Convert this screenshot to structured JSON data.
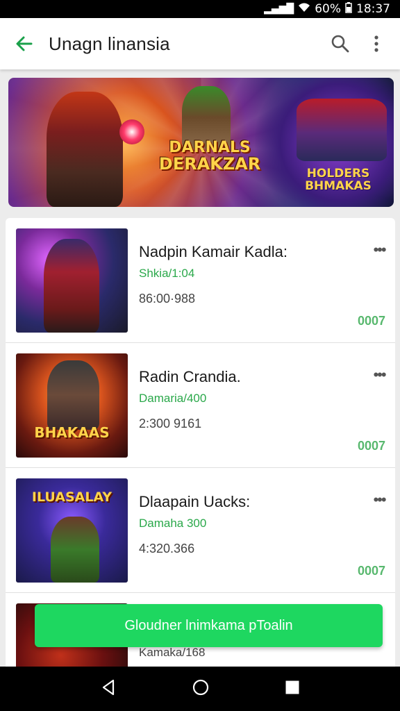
{
  "status_bar": {
    "signal": "▲▂▄▆",
    "battery_text": "60%",
    "time": "18:37"
  },
  "app_bar": {
    "title": "Unagn linansia"
  },
  "banner": {
    "title_line1": "DARNALS",
    "title_line2": "DERAKZAR",
    "right_title": "HOLDERS BHMAKAS"
  },
  "list": [
    {
      "title": "Nadpin Kamair Kadla:",
      "subtitle": "Shkia/1:04",
      "meta": "86:00·988",
      "count": "0007",
      "thumb_label": ""
    },
    {
      "title": "Radin Crandia.",
      "subtitle": "Damaria/400",
      "meta": "2:300 9161",
      "count": "0007",
      "thumb_label": "BHAKAAS"
    },
    {
      "title": "Dlaapain Uacks:",
      "subtitle": "Damaha 300",
      "meta": "4:320.366",
      "count": "0007",
      "thumb_label": "ILUASALAY"
    },
    {
      "title": "",
      "subtitle": "Kamaka/168",
      "meta": "",
      "count": "",
      "thumb_label": ""
    }
  ],
  "cta": {
    "label": "Gloudner lnimkama pToalin"
  },
  "colors": {
    "accent": "#1ed760",
    "link_green": "#2aa84a",
    "back_arrow": "#1aa04a"
  },
  "icons": {
    "back": "arrow-left-icon",
    "search": "search-icon",
    "more": "more-vert-icon"
  }
}
